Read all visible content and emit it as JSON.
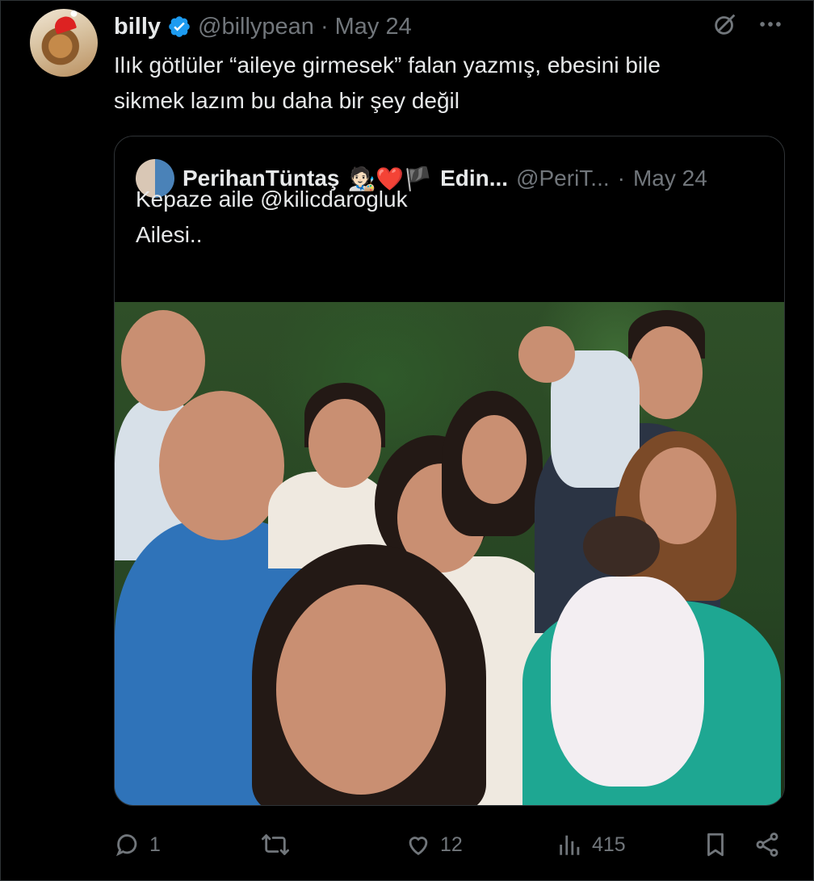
{
  "tweet": {
    "display_name": "billy",
    "handle": "@billypean",
    "separator": "·",
    "date": "May 24",
    "text": "Ilık götlüler “aileye girmesek” falan yazmış, ebesini bile\nsikmek lazım bu daha bir şey değil",
    "avatar_icon": "avatar-icon",
    "verified_icon": "verified-badge-icon",
    "grok_icon": "grok-icon",
    "more_icon": "more-icon"
  },
  "quote": {
    "display_name": "PerihanTüntaş",
    "emoji_glyphs": "🧑🏻‍🎨❤️🏴",
    "name_suffix": "Edin...",
    "handle": "@PeriT...",
    "separator": "·",
    "date": "May 24",
    "text": "Kepaze aile @kilicdarogluk\nAilesi..",
    "photo_icon": "family-selfie-photo"
  },
  "actions": {
    "reply_count": "1",
    "retweet_count": "",
    "like_count": "12",
    "views_count": "415",
    "icons": {
      "reply": "reply-icon",
      "retweet": "retweet-icon",
      "like": "like-icon",
      "views": "views-icon",
      "bookmark": "bookmark-icon",
      "share": "share-icon"
    }
  },
  "colors": {
    "background": "#000000",
    "text_primary": "#e7e9ea",
    "text_secondary": "#71767b",
    "verified": "#1d9bf0",
    "border": "#2f3336"
  }
}
